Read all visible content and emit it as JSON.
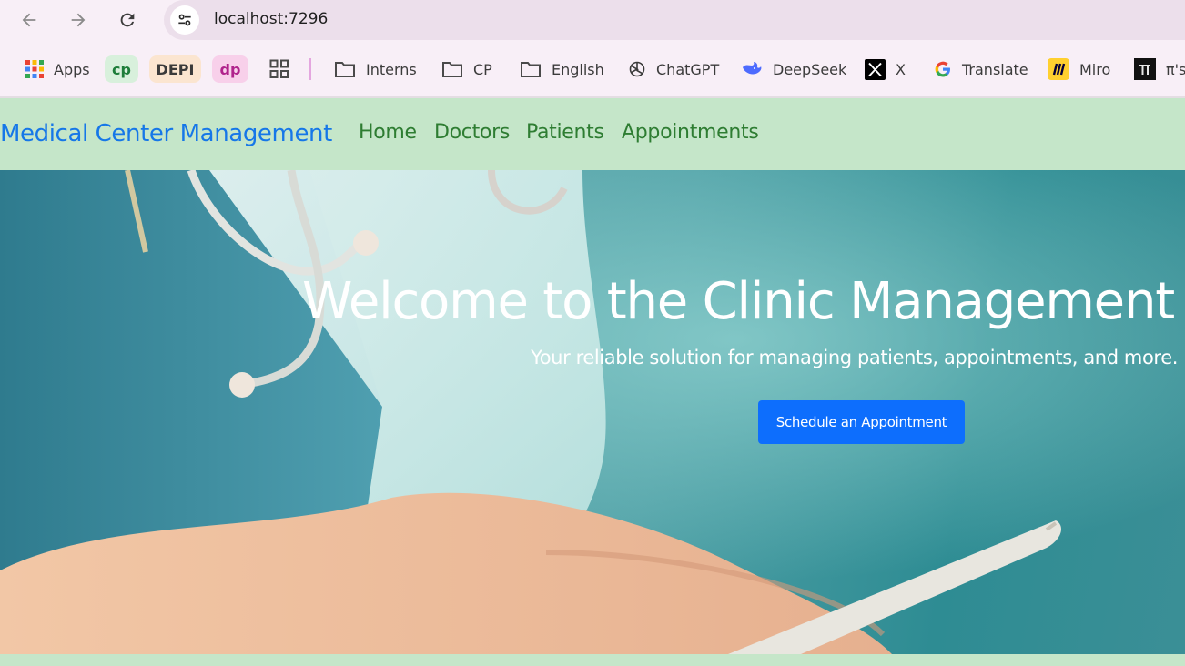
{
  "browser": {
    "url": "localhost:7296",
    "bookmarks": {
      "apps": "Apps",
      "cp_chip": "cp",
      "depi_chip": "DEPI",
      "dp_chip": "dp",
      "interns": "Interns",
      "cp_folder": "CP",
      "english": "English",
      "chatgpt": "ChatGPT",
      "deepseek": "DeepSeek",
      "x": "X",
      "translate": "Translate",
      "miro": "Miro",
      "pi": "π's"
    }
  },
  "navbar": {
    "brand": "Medical Center Management",
    "links": [
      "Home",
      "Doctors",
      "Patients",
      "Appointments"
    ]
  },
  "hero": {
    "title": "Welcome to the Clinic Management",
    "subtitle": "Your reliable solution for managing patients, appointments, and more.",
    "button": "Schedule an Appointment"
  },
  "colors": {
    "navbar_bg": "#c5e6c9",
    "brand": "#1677e8",
    "nav_link": "#2e7d32",
    "primary_button": "#0d6efd"
  }
}
